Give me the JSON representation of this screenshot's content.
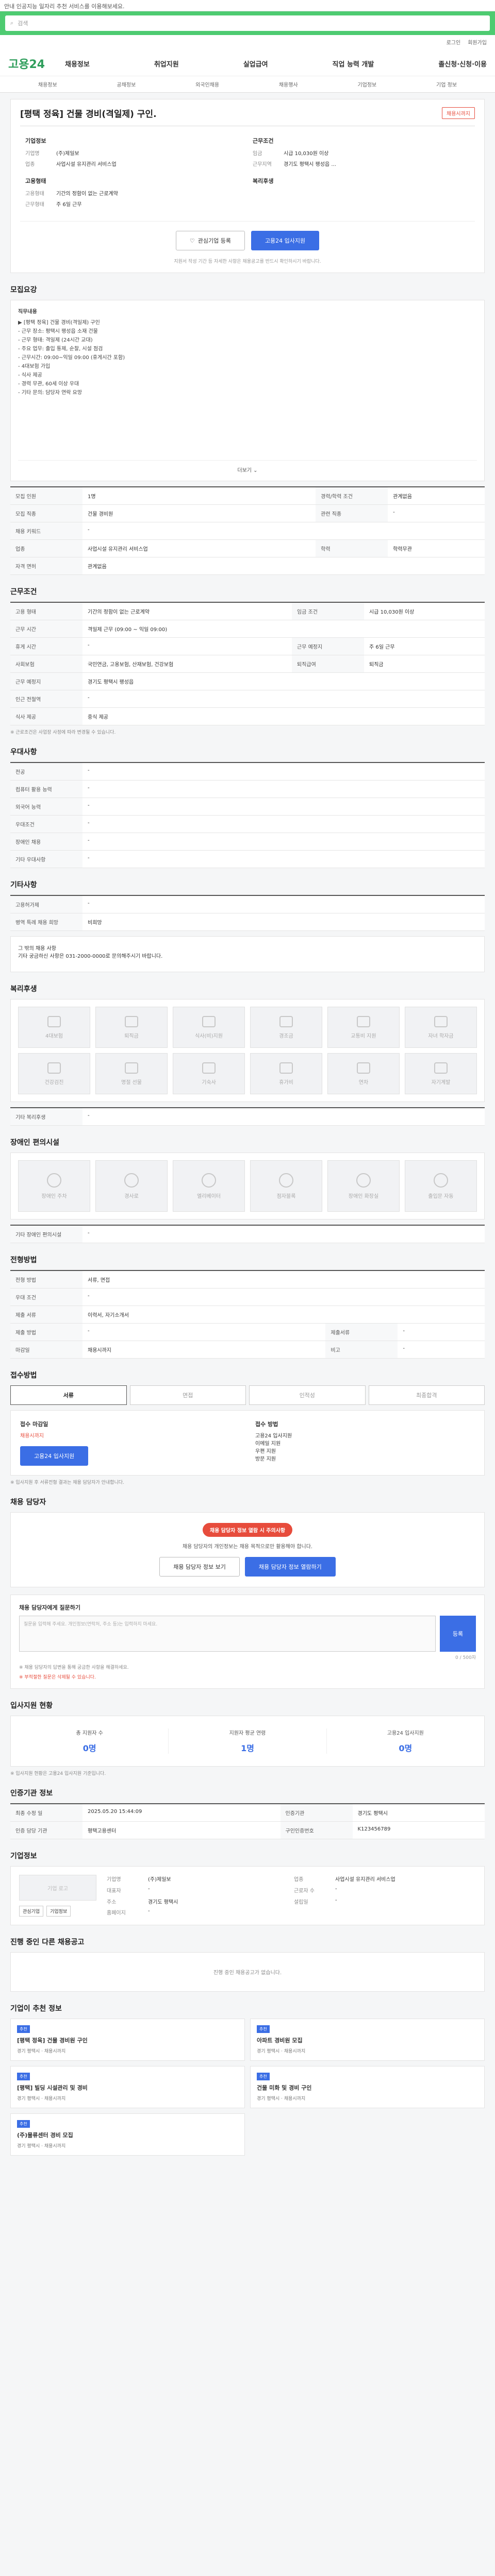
{
  "notice": "안내 인공지능 일자리 추천 서비스를 이용해보세요.",
  "search": {
    "placeholder": "검색"
  },
  "util": [
    "로그인",
    "회원가입"
  ],
  "header": {
    "logo_prefix": "고용",
    "logo_suffix": "24",
    "nav": [
      "채용정보",
      "취업지원",
      "실업급여",
      "직업 능력 개발",
      "졸신청·신청·이용"
    ],
    "sub_nav": [
      "채용정보",
      "공채정보",
      "외국인채용",
      "채용행사",
      "기업정보",
      "기업 정보"
    ]
  },
  "job": {
    "title": "[평택 정육] 건물 경비(격일제) 구인.",
    "status": "채용시까지",
    "company_heading": "기업정보",
    "company": [
      {
        "k": "기업명",
        "v": "(주)제일보"
      },
      {
        "k": "업종",
        "v": "사업시설 유지관리 서비스업"
      }
    ],
    "employer_heading": "고용형태",
    "employer": [
      {
        "k": "고용형태",
        "v": "기간의 정함이 없는 근로계약"
      },
      {
        "k": "근무형태",
        "v": "주 6일 근무"
      }
    ],
    "cond_heading": "근무조건",
    "cond": [
      {
        "k": "임금",
        "v": "시급 10,030원 이상"
      },
      {
        "k": "근무지역",
        "v": "경기도 평택시 팽성읍 ..."
      }
    ],
    "welfare_heading": "복리후생",
    "buttons": {
      "interest": "관심기업 등록",
      "apply": "고용24 입사지원"
    },
    "note": "지원서 작성 기간 등 자세한 사항은 채용공고를 반드시 확인하시기 바랍니다."
  },
  "sections": {
    "recruit": "모집요강",
    "work_cond": "근무조건",
    "pref": "우대사항",
    "extra": "기타사항",
    "welfare": "복리후생",
    "disability": "장애인 편의시설",
    "selection": "전형방법",
    "apply": "접수방법",
    "manager": "채용 담당자",
    "qa": "채용 담당자에게 질문하기",
    "applicants": "입사지원 현황",
    "agency": "인증기관 정보",
    "corp": "기업정보",
    "corp_jobs": "진행 중인 다른 채용공고",
    "recommend": "기업이 추천 정보"
  },
  "recruit": {
    "desc_title": "직무내용",
    "desc_lines": [
      "▶ [평택 정육] 건물 경비(격일제) 구인",
      "- 근무 장소: 평택시 팽성읍 소재 건물",
      "- 근무 형태: 격일제 (24시간 교대)",
      "- 주요 업무: 출입 통제, 순찰, 시설 점검",
      "- 근무시간: 09:00~익일 09:00 (휴게시간 포함)",
      "- 4대보험 가입",
      "- 식사 제공",
      "- 경력 무관, 60세 이상 우대",
      "- 기타 문의: 담당자 연락 요망"
    ],
    "more": "더보기 ⌄",
    "rows": [
      [
        "모집 인원",
        "1명",
        "경력/학력 조건",
        "관계없음"
      ],
      [
        "모집 직종",
        "건물 경비원",
        "관련 직종",
        "-"
      ],
      [
        "채용 키워드",
        "-",
        "",
        ""
      ],
      [
        "업종",
        "사업시설 유지관리 서비스업",
        "학력",
        "학력무관"
      ],
      [
        "자격 면허",
        "관계없음",
        "",
        ""
      ]
    ]
  },
  "work": {
    "rows": [
      [
        "고용 형태",
        "기간의 정함이 없는 근로계약",
        "임금 조건",
        "시급 10,030원 이상"
      ],
      [
        "근무 시간",
        "격일제 근무 (09:00 ~ 익일 09:00)",
        "",
        ""
      ],
      [
        "휴게 시간",
        "-",
        "근무 예정지",
        "주 6일 근무"
      ],
      [
        "사회보험",
        "국민연금, 고용보험, 산재보험, 건강보험",
        "퇴직급여",
        "퇴직금"
      ],
      [
        "근무 예정지",
        "경기도 평택시 팽성읍",
        "",
        ""
      ],
      [
        "인근 전철역",
        "-",
        "",
        ""
      ],
      [
        "식사 제공",
        "중식 제공",
        "",
        ""
      ]
    ],
    "note": "※ 근로조건은 사업장 사정에 따라 변경될 수 있습니다."
  },
  "pref": {
    "rows": [
      [
        "전공",
        "-"
      ],
      [
        "컴퓨터 활용 능력",
        "-"
      ],
      [
        "외국어 능력",
        "-"
      ],
      [
        "우대조건",
        "-"
      ],
      [
        "장애인 채용",
        "-"
      ],
      [
        "기타 우대사항",
        "-"
      ]
    ]
  },
  "extra": {
    "rows": [
      [
        "고용허가제",
        "-"
      ],
      [
        "병역 특례 채용 희망",
        "비희망"
      ]
    ],
    "text": "그 밖의 채용 사항\n기타 궁금하신 사항은 031-2000-0000로 문의해주시기 바랍니다."
  },
  "welfare": {
    "items": [
      "4대보험",
      "퇴직금",
      "식사(비)지원",
      "경조금",
      "교통비 지원",
      "자녀 학자금",
      "건강검진",
      "명절 선물",
      "기숙사",
      "휴가비",
      "연차",
      "자기계발"
    ],
    "extra_label": "기타 복리후생",
    "extra_value": "-"
  },
  "disability": {
    "items": [
      "장애인 주차",
      "경사로",
      "엘리베이터",
      "점자블록",
      "장애인 화장실",
      "출입문 자동"
    ],
    "extra_label": "기타 장애인 편의시설",
    "extra_value": "-"
  },
  "selection": {
    "rows": [
      [
        "전형 방법",
        "서류, 면접"
      ],
      [
        "우대 조건",
        "-"
      ],
      [
        "제출 서류",
        "이력서, 자기소개서"
      ]
    ],
    "extra_rows": [
      [
        "제출 방법",
        "-",
        "제출서류",
        "-"
      ],
      [
        "마감일",
        "채용시까지",
        "비고",
        "-"
      ]
    ]
  },
  "apply": {
    "tabs": [
      "서류",
      "면접",
      "인적성",
      "최종합격"
    ],
    "col1_title": "접수 마감일",
    "col1_value": "채용시까지",
    "col1_btn": "고용24 입사지원",
    "col2_title": "접수 방법",
    "col2_lines": [
      "고용24 입사지원",
      "이메일 지원",
      "우편 지원",
      "방문 지원"
    ],
    "note": "※ 입사지원 후 서류전형 결과는 채용 담당자가 안내합니다."
  },
  "manager": {
    "bubble": "채용 담당자 정보 열람 시 주의사항",
    "text": "채용 담당자의 개인정보는 채용 목적으로만 활용해야 합니다.",
    "btn1": "채용 담당자 정보 보기",
    "btn2": "채용 담당자 정보 열람하기"
  },
  "qa": {
    "placeholder": "질문을 입력해 주세요. 개인정보(연락처, 주소 등)는 입력하지 마세요.",
    "submit": "등록",
    "count": "0 / 500자",
    "note1": "※ 채용 담당자의 답변을 통해 궁금한 사항을 해결하세요.",
    "note2": "※ 부적절한 질문은 삭제될 수 있습니다."
  },
  "applicants": {
    "stats": [
      {
        "label": "총 지원자 수",
        "value": "0명"
      },
      {
        "label": "지원자 평균 연령",
        "value": "1명"
      },
      {
        "label": "고용24 입사지원",
        "value": "0명"
      }
    ],
    "note": "※ 입사지원 현황은 고용24 입사지원 기준입니다."
  },
  "agency": {
    "rows": [
      [
        "최종 수정 일",
        "2025.05.20 15:44:09",
        "인증기관",
        "경기도 평택시"
      ],
      [
        "인증 담당 기관",
        "평택고용센터",
        "구인인증번호",
        "K123456789"
      ]
    ]
  },
  "corp": {
    "logo": "기업 로고",
    "btn1": "관심기업",
    "btn2": "기업정보",
    "info": [
      [
        "기업명",
        "(주)제일보",
        "업종",
        "사업시설 유지관리 서비스업"
      ],
      [
        "대표자",
        "-",
        "근로자 수",
        "-"
      ],
      [
        "주소",
        "경기도 평택시",
        "설립일",
        "-"
      ],
      [
        "홈페이지",
        "-",
        "",
        ""
      ]
    ]
  },
  "corp_jobs": {
    "empty": "진행 중인 채용공고가 없습니다."
  },
  "recommend": {
    "items": [
      {
        "tag": "추천",
        "title": "[평택 정육] 건물 경비원 구인",
        "meta": "경기 평택시 · 채용시까지"
      },
      {
        "tag": "추천",
        "title": "아파트 경비원 모집",
        "meta": "경기 평택시 · 채용시까지"
      },
      {
        "tag": "추천",
        "title": "[평택] 빌딩 시설관리 및 경비",
        "meta": "경기 평택시 · 채용시까지"
      },
      {
        "tag": "추천",
        "title": "건물 미화 및 경비 구인",
        "meta": "경기 평택시 · 채용시까지"
      },
      {
        "tag": "추천",
        "title": "(주)물류센터 경비 모집",
        "meta": "경기 평택시 · 채용시까지"
      }
    ]
  }
}
